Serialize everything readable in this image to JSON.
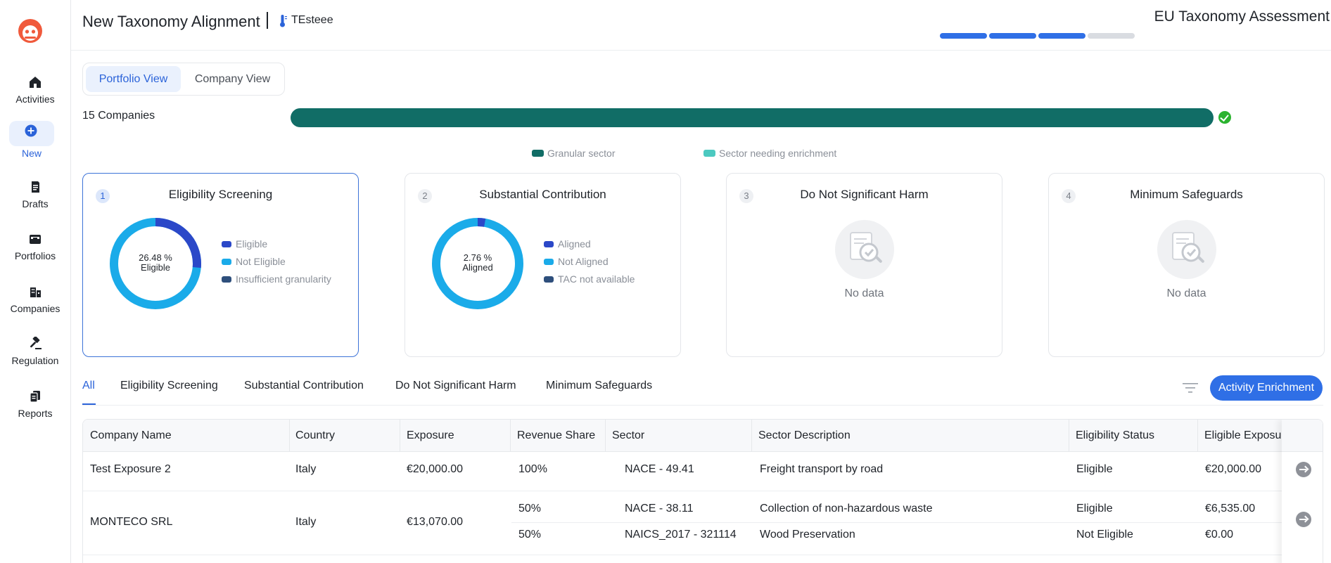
{
  "sidebar": {
    "items": [
      {
        "label": "Activities",
        "icon": "home-icon"
      },
      {
        "label": "New",
        "icon": "plus-circle-icon"
      },
      {
        "label": "Drafts",
        "icon": "document-icon"
      },
      {
        "label": "Portfolios",
        "icon": "inbox-icon"
      },
      {
        "label": "Companies",
        "icon": "buildings-icon"
      },
      {
        "label": "Regulation",
        "icon": "gavel-icon"
      },
      {
        "label": "Reports",
        "icon": "files-icon"
      }
    ],
    "active": "New"
  },
  "header": {
    "title": "New Taxonomy Alignment",
    "subtitle": "TEsteee",
    "assessment_title": "EU Taxonomy Assessment",
    "progress_steps_completed": 3,
    "progress_steps_total": 4
  },
  "view_toggle": {
    "options": [
      "Portfolio View",
      "Company View"
    ],
    "selected": "Portfolio View"
  },
  "companies_bar": {
    "label": "15 Companies",
    "granular_fraction": 1.0,
    "legend": [
      {
        "label": "Granular sector",
        "color": "#116d66"
      },
      {
        "label": "Sector needing enrichment",
        "color": "#4cc9c0"
      }
    ]
  },
  "cards": [
    {
      "number": "1",
      "title": "Eligibility Screening",
      "center_value": "26.48 %",
      "center_label": "Eligible",
      "segments": [
        {
          "label": "Eligible",
          "percent": 26.48,
          "color": "#2b48c8"
        },
        {
          "label": "Not Eligible",
          "percent": 73.52,
          "color": "#1aabe9"
        },
        {
          "label": "Insufficient granularity",
          "percent": 0,
          "color": "#2e4f7c"
        }
      ]
    },
    {
      "number": "2",
      "title": "Substantial Contribution",
      "center_value": "2.76 %",
      "center_label": "Aligned",
      "segments": [
        {
          "label": "Aligned",
          "percent": 2.76,
          "color": "#2b48c8"
        },
        {
          "label": "Not Aligned",
          "percent": 97.24,
          "color": "#1aabe9"
        },
        {
          "label": "TAC not available",
          "percent": 0,
          "color": "#2e4f7c"
        }
      ]
    },
    {
      "number": "3",
      "title": "Do Not Significant Harm",
      "no_data": "No data"
    },
    {
      "number": "4",
      "title": "Minimum Safeguards",
      "no_data": "No data"
    }
  ],
  "tabs": [
    "All",
    "Eligibility Screening",
    "Substantial Contribution",
    "Do Not Significant Harm",
    "Minimum Safeguards"
  ],
  "active_tab": "All",
  "enrich_button": "Activity Enrichment",
  "table": {
    "columns": [
      "Company Name",
      "Country",
      "Exposure",
      "Revenue Share",
      "Sector",
      "Sector Description",
      "Eligibility Status",
      "Eligible Exposu"
    ],
    "rows": [
      {
        "company": "Test Exposure 2",
        "country": "Italy",
        "exposure": "€20,000.00",
        "activities": [
          {
            "revenue_share": "100%",
            "sector": "NACE - 49.41",
            "description": "Freight transport by road",
            "status": "Eligible",
            "eligible_exposure": "€20,000.00"
          }
        ]
      },
      {
        "company": "MONTECO SRL",
        "country": "Italy",
        "exposure": "€13,070.00",
        "activities": [
          {
            "revenue_share": "50%",
            "sector": "NACE - 38.11",
            "description": "Collection of non-hazardous waste",
            "status": "Eligible",
            "eligible_exposure": "€6,535.00"
          },
          {
            "revenue_share": "50%",
            "sector": "NAICS_2017 - 321114",
            "description": "Wood Preservation",
            "status": "Not Eligible",
            "eligible_exposure": "€0.00"
          }
        ]
      }
    ]
  },
  "colors": {
    "accent": "#2b63d9",
    "primary_button": "#2f6fe6",
    "progress_done": "#2f6fe6",
    "progress_todo": "#d9dce1"
  }
}
